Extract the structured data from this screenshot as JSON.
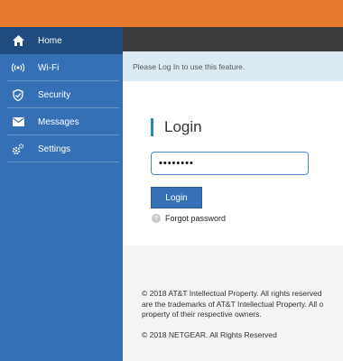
{
  "sidebar": {
    "items": [
      {
        "label": "Home",
        "icon": "home-icon"
      },
      {
        "label": "Wi-Fi",
        "icon": "wifi-icon"
      },
      {
        "label": "Security",
        "icon": "shield-icon"
      },
      {
        "label": "Messages",
        "icon": "envelope-icon"
      },
      {
        "label": "Settings",
        "icon": "gears-icon"
      }
    ]
  },
  "notice": {
    "text": "Please Log In to use this feature."
  },
  "login": {
    "title": "Login",
    "password_value": "••••••••",
    "button_label": "Login",
    "forgot_label": "Forgot password"
  },
  "footer": {
    "line1": "© 2018 AT&T Intellectual Property. All rights reserved",
    "line2": "are the trademarks of AT&T Intellectual Property. All o",
    "line3": "property of their respective owners.",
    "copyright": "© 2018 NETGEAR. All Rights Reserved"
  },
  "colors": {
    "orange": "#e87a2e",
    "sidebar_blue": "#3570b7",
    "active_blue": "#1f4b7e"
  }
}
